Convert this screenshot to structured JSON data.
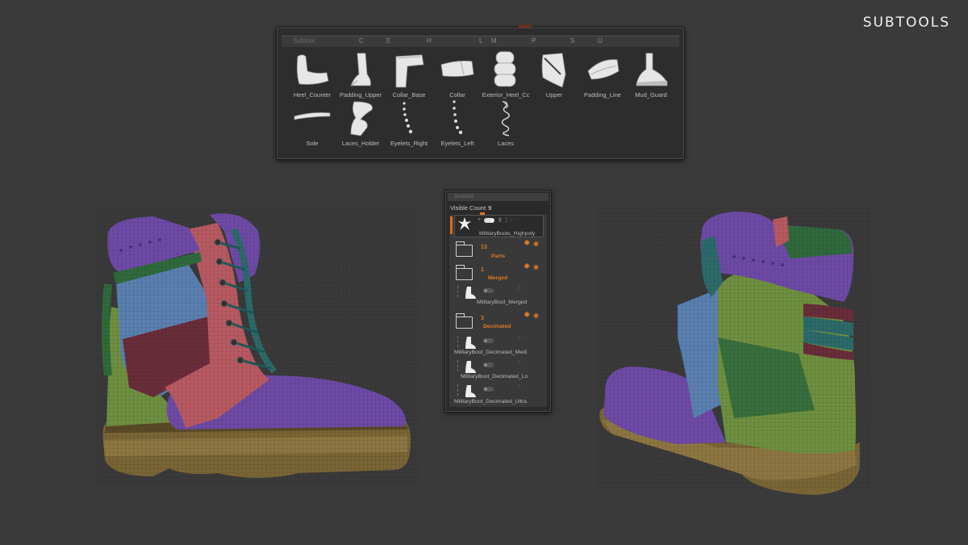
{
  "header": {
    "title": "SUBTOOLS"
  },
  "palette": {
    "title": "Subtool",
    "letters": [
      "C",
      "E",
      "H",
      "L",
      "M",
      "P",
      "S",
      "U"
    ],
    "tiles": [
      {
        "label": "Heel_Counter",
        "icon": "heel-counter-thumbnail"
      },
      {
        "label": "Padding_Upper",
        "icon": "padding-upper-thumbnail"
      },
      {
        "label": "Collar_Base",
        "icon": "collar-base-thumbnail"
      },
      {
        "label": "Collar",
        "icon": "collar-thumbnail"
      },
      {
        "label": "Exterior_Heel_Cc",
        "icon": "exterior-heel-thumbnail"
      },
      {
        "label": "Upper",
        "icon": "upper-thumbnail"
      },
      {
        "label": "Padding_Line",
        "icon": "padding-line-thumbnail"
      },
      {
        "label": "Mud_Guard",
        "icon": "mud-guard-thumbnail"
      },
      {
        "label": "Sole",
        "icon": "sole-thumbnail"
      },
      {
        "label": "Laces_Holder",
        "icon": "laces-holder-thumbnail"
      },
      {
        "label": "Eyelets_Right",
        "icon": "eyelets-right-thumbnail"
      },
      {
        "label": "Eyelets_Left",
        "icon": "eyelets-left-thumbnail"
      },
      {
        "label": "Laces",
        "icon": "laces-thumbnail"
      }
    ]
  },
  "subtool_list": {
    "title": "Subtool",
    "visible_count_label": "Visible Count",
    "visible_count": "9",
    "items": [
      {
        "type": "mesh",
        "name": "MilitaryBoots_Highpoly",
        "selected": true
      },
      {
        "type": "folder",
        "count": "13",
        "name": "Parts"
      },
      {
        "type": "folder",
        "count": "1",
        "name": "Merged"
      },
      {
        "type": "mesh",
        "name": "MilitaryBoot_Merged"
      },
      {
        "type": "folder",
        "count": "3",
        "name": "Decimated"
      },
      {
        "type": "mesh",
        "name": "MilitaryBoot_Decimated_Medi"
      },
      {
        "type": "mesh",
        "name": "MilitaryBoot_Decimated_Lo"
      },
      {
        "type": "mesh",
        "name": "MilitaryBoot_Decimated_Ultra"
      }
    ]
  },
  "colors": {
    "background": "#3a3a3a",
    "accent_orange": "#e07020",
    "boot_purple": "#6e4aa6",
    "boot_blue": "#5a80b0",
    "boot_red": "#b85a62",
    "boot_maroon": "#6a2d3a",
    "boot_green": "#6e9040",
    "boot_dark_green": "#2f6a3c",
    "boot_teal": "#2d6a6a",
    "sole_brown": "#7a6535"
  }
}
